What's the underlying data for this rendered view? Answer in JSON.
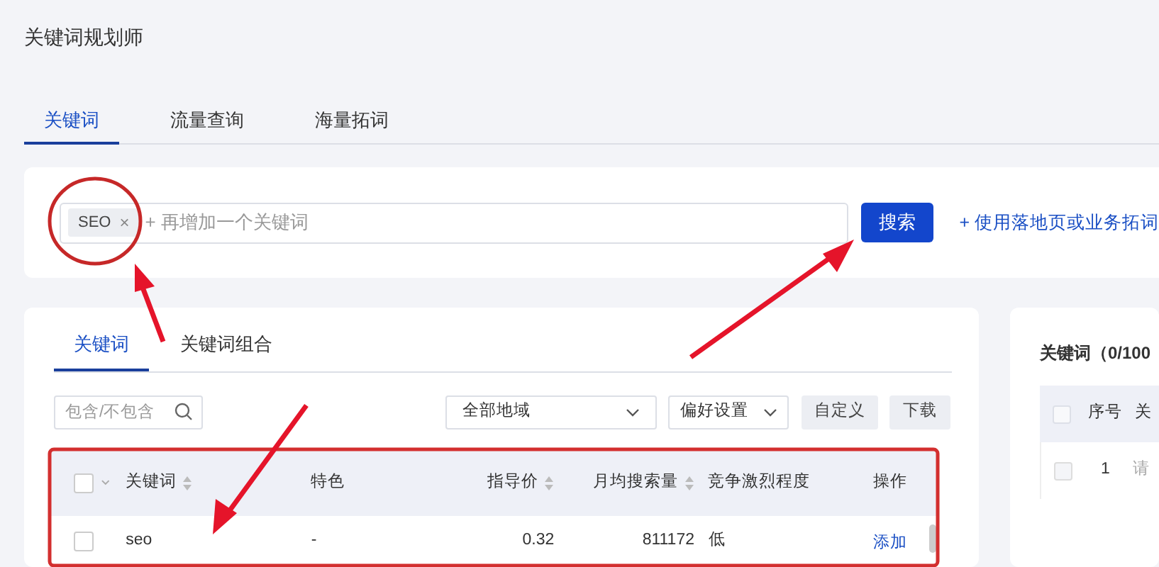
{
  "title": "关键词规划师",
  "tabs": [
    {
      "label": "关键词",
      "selected": true
    },
    {
      "label": "流量查询",
      "selected": false
    },
    {
      "label": "海量拓词",
      "selected": false
    }
  ],
  "search": {
    "chips": [
      {
        "label": "SEO",
        "remove": "×"
      }
    ],
    "placeholder": "+ 再增加一个关键词",
    "button": "搜索",
    "link": "+ 使用落地页或业务拓词"
  },
  "results": {
    "tabs": [
      {
        "label": "关键词",
        "selected": true
      },
      {
        "label": "关键词组合",
        "selected": false
      }
    ],
    "filter_placeholder": "包含/不包含",
    "region": "全部地域",
    "preferences": "偏好设置",
    "buttons": [
      "自定义",
      "下载"
    ],
    "table": {
      "select_all_checked": false,
      "columns": [
        {
          "label": "关键词",
          "sortable": true
        },
        {
          "label": "特色",
          "sortable": false
        },
        {
          "label": "指导价",
          "sortable": true
        },
        {
          "label": "月均搜索量",
          "sortable": true
        },
        {
          "label": "竞争激烈程度",
          "sortable": false
        },
        {
          "label": "操作",
          "sortable": false
        }
      ],
      "rows": [
        {
          "checked": false,
          "cells": [
            "seo",
            "-",
            "0.32",
            "811172",
            "低"
          ],
          "action": "添加"
        }
      ]
    }
  },
  "selected_panel": {
    "title": "关键词（0/100",
    "select_all_checked": false,
    "columns": [
      "序号",
      "关"
    ],
    "rows": [
      {
        "checked": false,
        "cells": [
          "1",
          "请"
        ]
      }
    ]
  }
}
